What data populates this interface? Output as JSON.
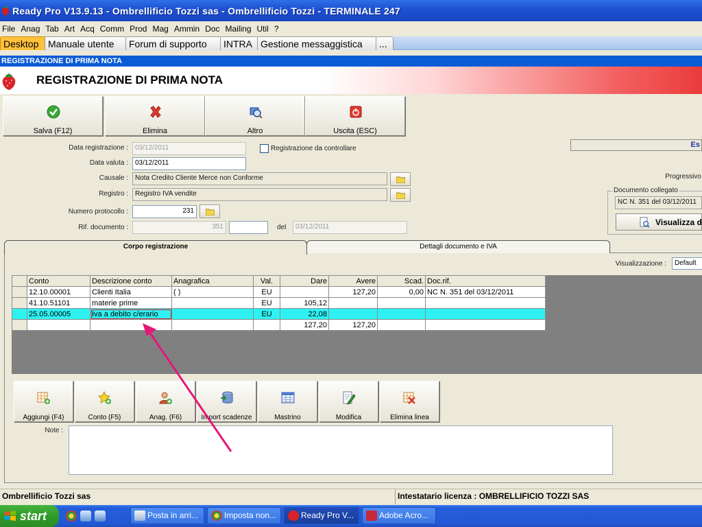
{
  "window": {
    "title": "Ready Pro V13.9.13 - Ombrellificio Tozzi sas - Ombrellificio Tozzi - TERMINALE 247"
  },
  "menu": [
    "File",
    "Anag",
    "Tab",
    "Art",
    "Acq",
    "Comm",
    "Prod",
    "Mag",
    "Ammin",
    "Doc",
    "Mailing",
    "Util",
    "?"
  ],
  "tabs": [
    "Desktop",
    "Manuale utente",
    "Forum di supporto",
    "INTRA",
    "Gestione messaggistica",
    "..."
  ],
  "section_title": "REGISTRAZIONE DI PRIMA NOTA",
  "page_title": "REGISTRAZIONE DI PRIMA NOTA",
  "toolbar": {
    "save": "Salva (F12)",
    "delete": "Elimina",
    "other": "Altro",
    "exit": "Uscita (ESC)"
  },
  "form": {
    "data_registrazione_label": "Data registrazione :",
    "data_registrazione": "03/12/2011",
    "reg_da_controllare_label": "Registrazione da controllare",
    "data_valuta_label": "Data valuta :",
    "data_valuta": "03/12/2011",
    "causale_label": "Causale :",
    "causale": "Nota Credito Cliente Merce non Conforme",
    "registro_label": "Registro :",
    "registro": "Registro IVA vendite",
    "numero_protocollo_label": "Numero protocollo :",
    "numero_protocollo": "231",
    "rif_documento_label": "Rif. documento :",
    "rif_documento": "351",
    "rif_documento_suffix": "",
    "del_label": "del",
    "del_date": "03/12/2011",
    "esercizio": "Es",
    "progressivo_label": "Progressivo",
    "documento_collegato_label": "Documento collegato",
    "documento_collegato": "NC N. 351 del 03/12/2011",
    "visualizza": "Visualizza do"
  },
  "inner_tabs": {
    "corpo": "Corpo registrazione",
    "dettagli": "Dettagli documento e IVA"
  },
  "visualizzazione": {
    "label": "Visualizzazione :",
    "value": "Default"
  },
  "grid": {
    "headers": [
      "Conto",
      "Descrizione conto",
      "Anagrafica",
      "Val.",
      "Dare",
      "Avere",
      "Scad.",
      "Doc.rif."
    ],
    "rows": [
      {
        "conto": "12.10.00001",
        "descrizione": "Clienti Italia",
        "anagrafica": "(                          )",
        "val": "EU",
        "dare": "",
        "avere": "127,20",
        "scad": "0,00",
        "docrif": "NC N. 351 del 03/12/2011"
      },
      {
        "conto": "41.10.51101",
        "descrizione": "materie prime",
        "anagrafica": "",
        "val": "EU",
        "dare": "105,12",
        "avere": "",
        "scad": "",
        "docrif": ""
      },
      {
        "conto": "25.05.00005",
        "descrizione": "Iva a debito c/erario",
        "anagrafica": "",
        "val": "EU",
        "dare": "22,08",
        "avere": "",
        "scad": "",
        "docrif": ""
      }
    ],
    "totals": {
      "dare": "127,20",
      "avere": "127,20"
    }
  },
  "actions": {
    "add": "Aggiungi (F4)",
    "conto": "Conto (F5)",
    "anag": "Anag. (F6)",
    "import": "Import scadenze",
    "mastrino": "Mastrino",
    "modifica": "Modifica",
    "elimina_linea": "Elimina linea"
  },
  "note_label": "Note :",
  "statusbar": {
    "company": "Ombrellificio Tozzi sas",
    "licence": "Intestatario licenza : OMBRELLIFICIO TOZZI SAS"
  },
  "taskbar": {
    "start": "start",
    "items": [
      "Posta in arri...",
      "Imposta non...",
      "Ready Pro V...",
      "Adobe Acro..."
    ]
  },
  "colors": {
    "accent_blue": "#0a5bd6",
    "selected_row": "#2ef2f2",
    "annotation_arrow": "#e5167a",
    "active_tab": "#ffc13a"
  }
}
